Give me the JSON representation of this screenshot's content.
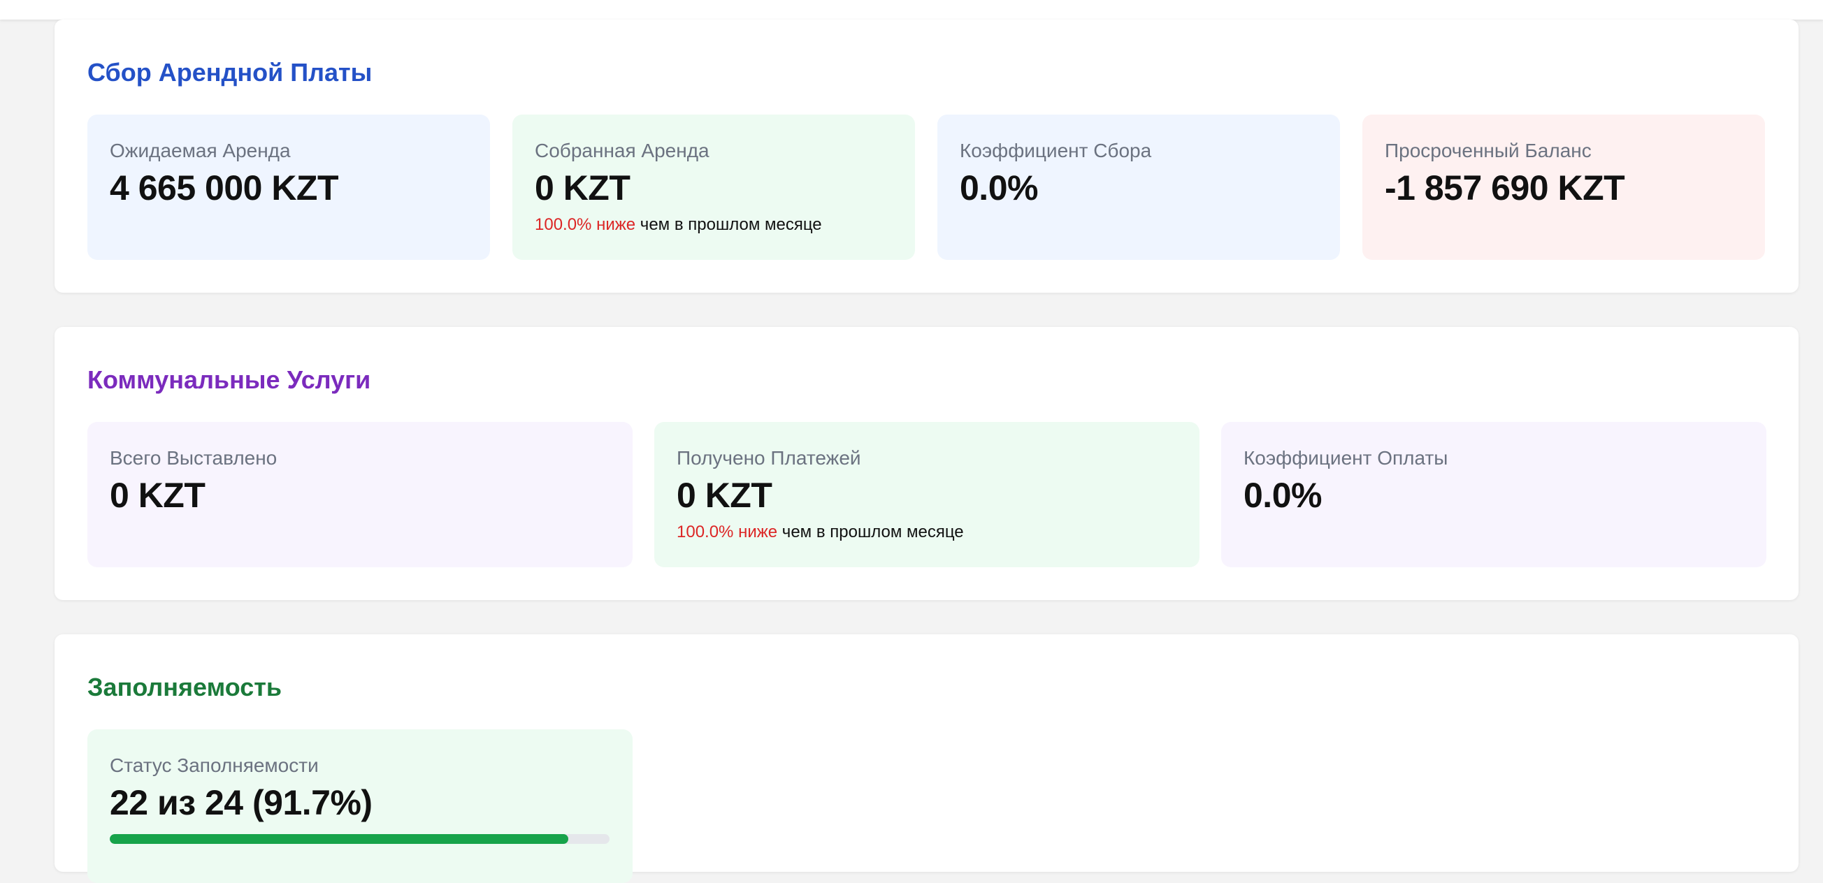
{
  "colors": {
    "rent_title": "#2451c7",
    "utilities_title": "#7b2bbd",
    "occupancy_title": "#1b7a3a",
    "negative": "#dc2626",
    "progress_fill": "#16a34a"
  },
  "rent": {
    "title": "Сбор Арендной Платы",
    "cards": [
      {
        "label": "Ожидаемая Аренда",
        "value": "4 665 000 KZT"
      },
      {
        "label": "Собранная Аренда",
        "value": "0 KZT",
        "change_pct": "100.0% ниже",
        "change_text": " чем в прошлом месяце"
      },
      {
        "label": "Коэффициент Сбора",
        "value": "0.0%"
      },
      {
        "label": "Просроченный Баланс",
        "value": "-1 857 690 KZT"
      }
    ]
  },
  "utilities": {
    "title": "Коммунальные Услуги",
    "cards": [
      {
        "label": "Всего Выставлено",
        "value": "0 KZT"
      },
      {
        "label": "Получено Платежей",
        "value": "0 KZT",
        "change_pct": "100.0% ниже",
        "change_text": " чем в прошлом месяце"
      },
      {
        "label": "Коэффициент Оплаты",
        "value": "0.0%"
      }
    ]
  },
  "occupancy": {
    "title": "Заполняемость",
    "card": {
      "label": "Статус Заполняемости",
      "value": "22 из 24 (91.7%)",
      "progress_fraction": 0.917
    }
  }
}
